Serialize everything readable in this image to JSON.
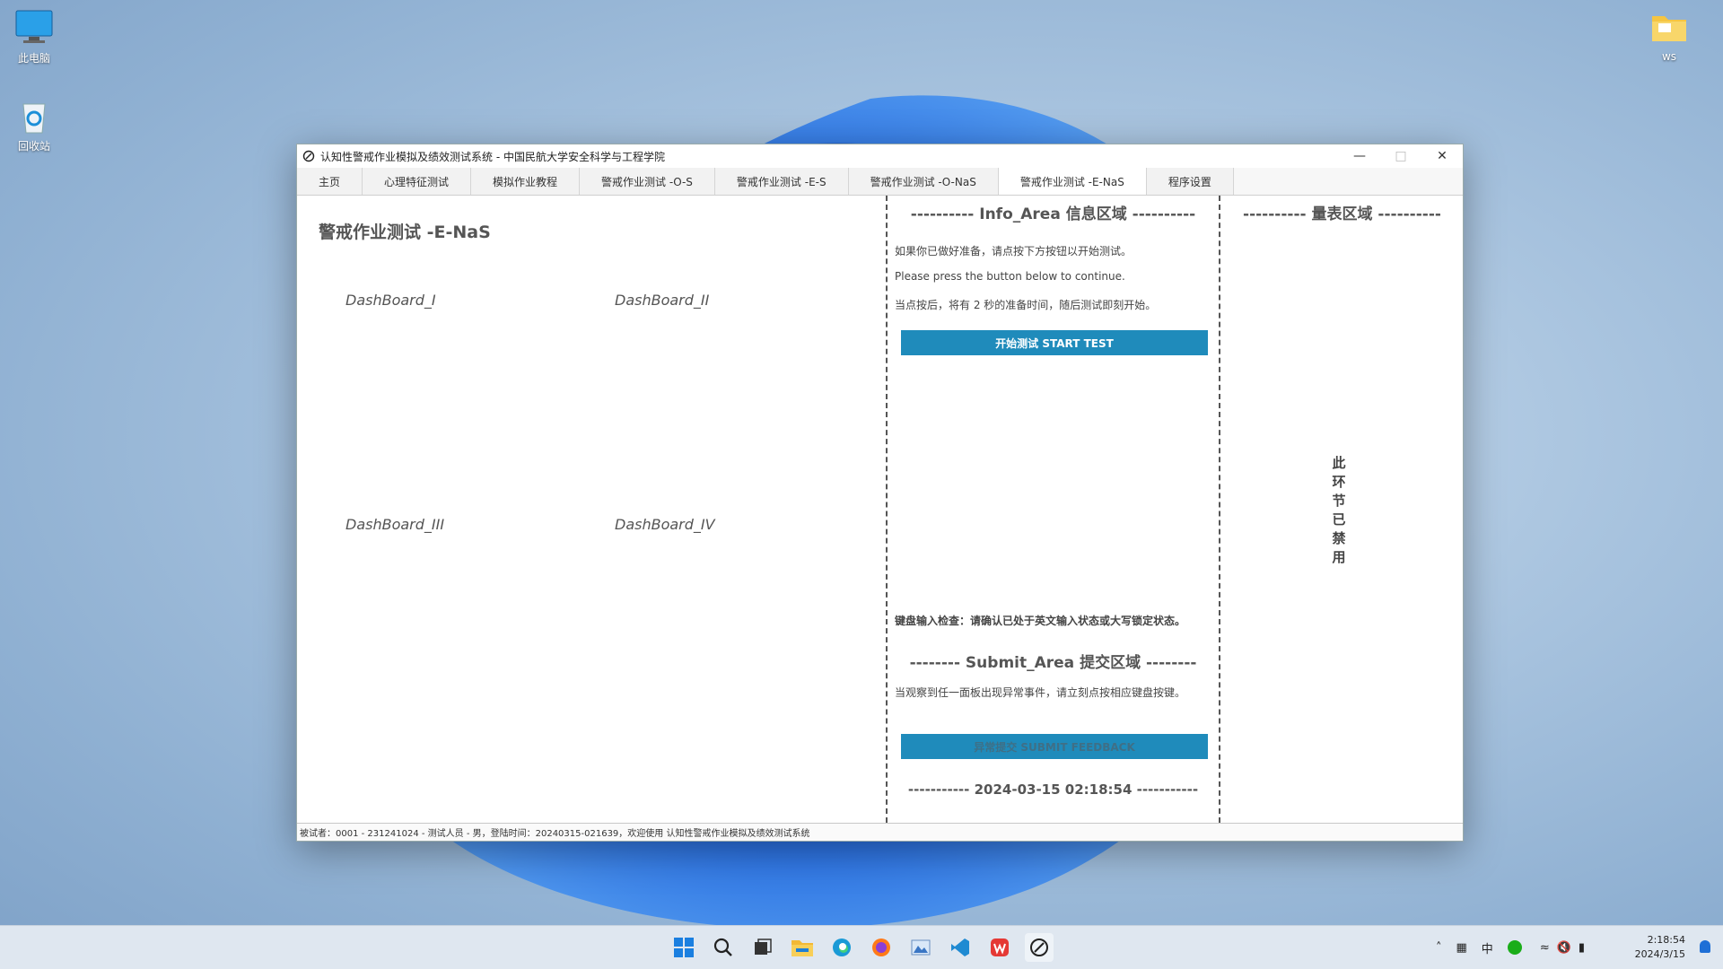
{
  "desktop": {
    "icons": [
      {
        "label": "此电脑"
      },
      {
        "label": "回收站"
      },
      {
        "label": "ws"
      }
    ]
  },
  "window": {
    "title": "认知性警戒作业模拟及绩效测试系统 - 中国民航大学安全科学与工程学院",
    "tabs": [
      {
        "label": "主页"
      },
      {
        "label": "心理特征测试"
      },
      {
        "label": "模拟作业教程"
      },
      {
        "label": "警戒作业测试 -O-S"
      },
      {
        "label": "警戒作业测试 -E-S"
      },
      {
        "label": "警戒作业测试 -O-NaS"
      },
      {
        "label": "警戒作业测试 -E-NaS"
      },
      {
        "label": "程序设置"
      }
    ],
    "active_tab": "警戒作业测试 -E-NaS"
  },
  "main": {
    "page_title": "警戒作业测试 -E-NaS",
    "dashboards": [
      "DashBoard_I",
      "DashBoard_II",
      "DashBoard_III",
      "DashBoard_IV"
    ]
  },
  "info": {
    "header": "---------- Info_Area 信息区域 ----------",
    "line1": "如果你已做好准备，请点按下方按钮以开始测试。",
    "line2": "Please press the button below to continue.",
    "line3": "当点按后，将有 2 秒的准备时间，随后测试即刻开始。",
    "start_button": "开始测试 START TEST",
    "keyboard_check": "键盘输入检查：请确认已处于英文输入状态或大写锁定状态。",
    "submit_header": "-------- Submit_Area 提交区域 --------",
    "submit_line": "当观察到任一面板出现异常事件，请立刻点按相应键盘按键。",
    "submit_button": "异常提交 SUBMIT FEEDBACK",
    "datetime_line": "----------- 2024-03-15 02:18:54 -----------"
  },
  "scale": {
    "header": "---------- 量表区域 ----------",
    "disabled_text": [
      "此",
      "环",
      "节",
      "已",
      "禁",
      "用"
    ]
  },
  "status_bar": "被试者：0001 - 231241024 - 测试人员 - 男，登陆时间：20240315-021639，欢迎使用 认知性警戒作业模拟及绩效测试系统",
  "taskbar": {
    "apps": [
      "start-icon",
      "search-icon",
      "task-view-icon",
      "file-explorer-icon",
      "edge-icon",
      "firefox-icon",
      "photos-icon",
      "vscode-icon",
      "wps-icon",
      "app-icon"
    ],
    "ime": "中",
    "time": "2:18:54",
    "date": "2024/3/15"
  },
  "colors": {
    "accent": "#1f8bbb",
    "taskbar": "#dfe7f0"
  }
}
